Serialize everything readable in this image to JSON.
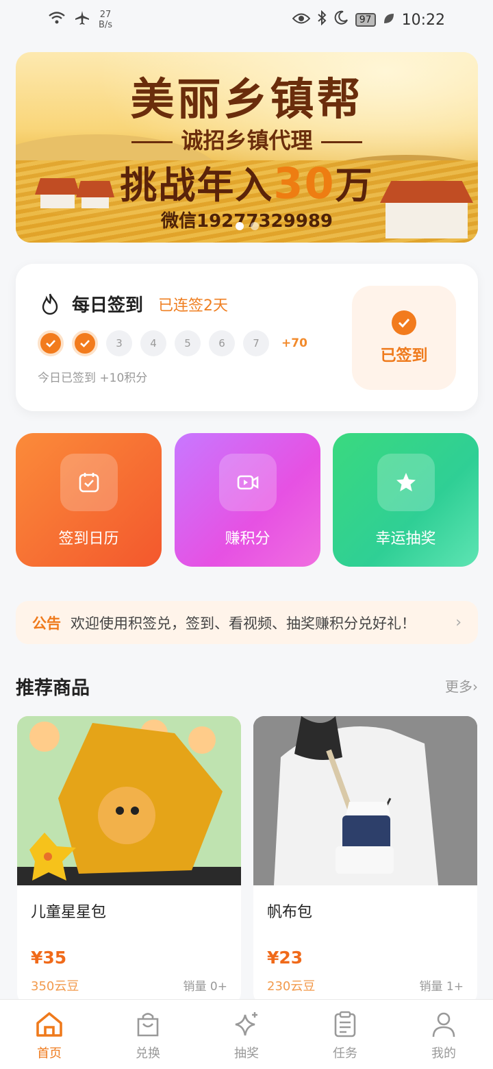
{
  "status_bar": {
    "net_speed": "27",
    "net_unit": "B/s",
    "battery": "97",
    "time": "10:22"
  },
  "banner": {
    "title": "美丽乡镇帮",
    "subtitle": "诚招乡镇代理",
    "main_prefix": "挑战年入",
    "main_highlight": "30",
    "main_suffix": "万",
    "wechat": "微信19277329989"
  },
  "checkin": {
    "title": "每日签到",
    "streak": "已连签2天",
    "days": [
      "",
      "",
      "3",
      "4",
      "5",
      "6",
      "7"
    ],
    "bonus": "+70",
    "note": "今日已签到 +10积分",
    "button_label": "已签到"
  },
  "tiles": [
    {
      "label": "签到日历",
      "icon": "calendar-check-icon"
    },
    {
      "label": "赚积分",
      "icon": "video-icon"
    },
    {
      "label": "幸运抽奖",
      "icon": "star-icon"
    }
  ],
  "notice": {
    "tag": "公告",
    "text": "欢迎使用积签兑，签到、看视频、抽奖赚积分兑好礼！",
    "arrow": "›"
  },
  "section": {
    "title": "推荐商品",
    "more": "更多›"
  },
  "products": [
    {
      "name": "儿童星星包",
      "price": "¥35",
      "points": "350云豆",
      "sales": "销量 0+"
    },
    {
      "name": "帆布包",
      "price": "¥23",
      "points": "230云豆",
      "sales": "销量 1+"
    }
  ],
  "nav": [
    {
      "label": "首页",
      "icon": "home-icon"
    },
    {
      "label": "兑换",
      "icon": "shopping-bag-icon"
    },
    {
      "label": "抽奖",
      "icon": "sparkle-icon"
    },
    {
      "label": "任务",
      "icon": "clipboard-icon"
    },
    {
      "label": "我的",
      "icon": "user-icon"
    }
  ],
  "colors": {
    "accent": "#F27B1D",
    "background": "#F6F7F9"
  }
}
